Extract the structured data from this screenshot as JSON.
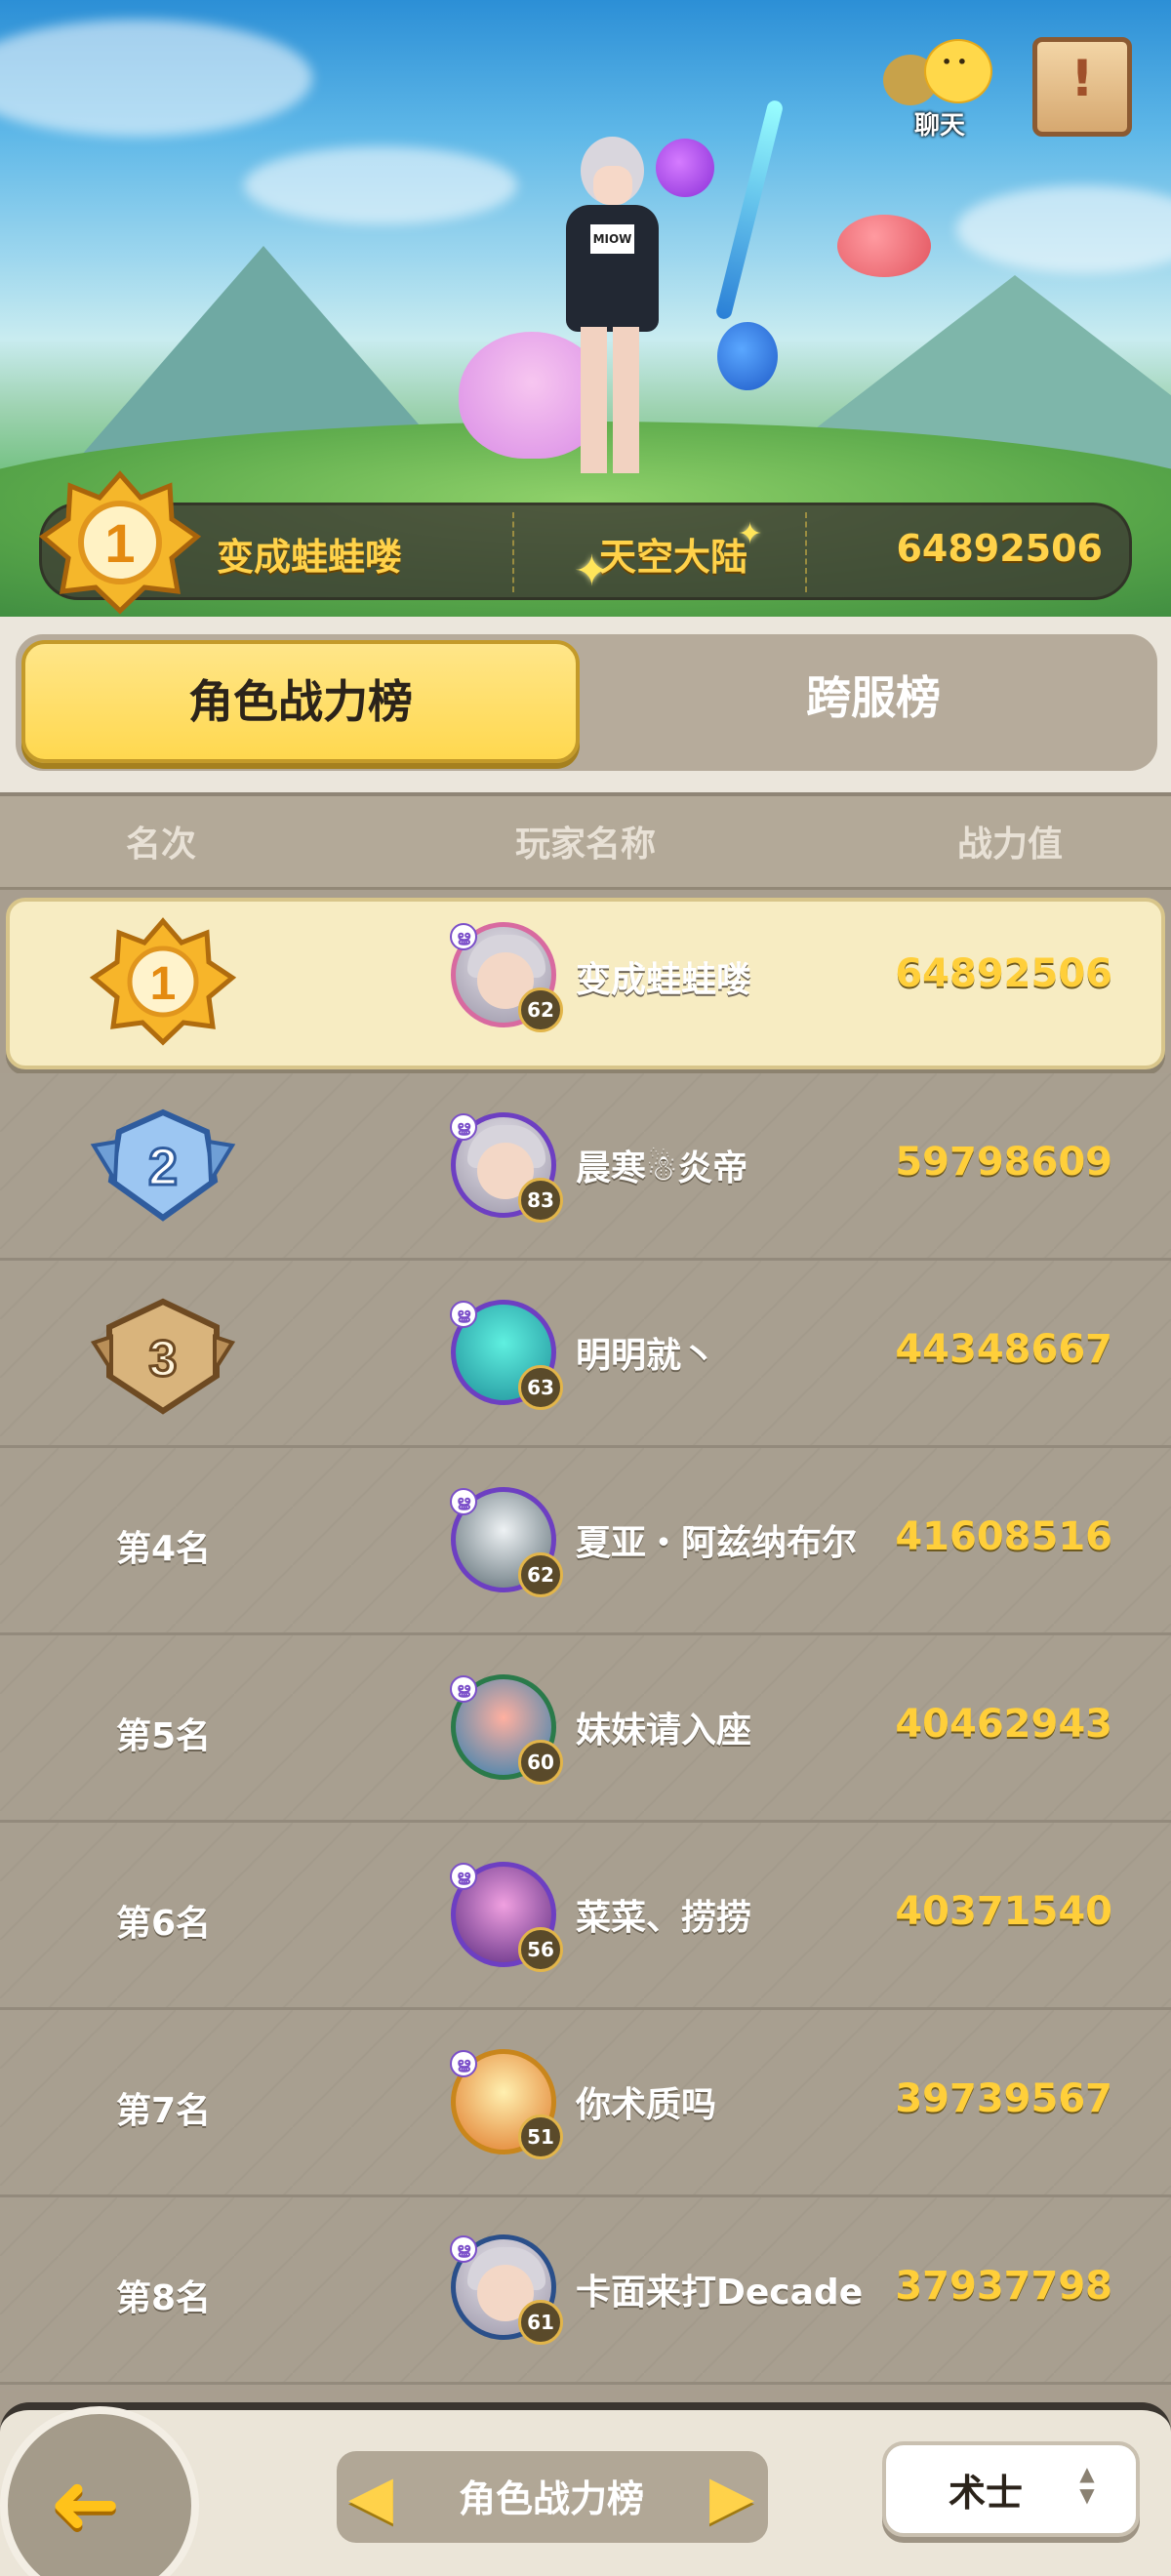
{
  "hero": {
    "chat_label": "聊天",
    "notice_icon": "!",
    "shirt_text": "MIOW"
  },
  "champion": {
    "rank": "1",
    "name": "变成蛙蛙喽",
    "server": "天空大陆",
    "power": "64892506"
  },
  "tabs": [
    {
      "label": "角色战力榜",
      "active": true
    },
    {
      "label": "跨服榜",
      "active": false
    }
  ],
  "table": {
    "headers": {
      "rank": "名次",
      "name": "玩家名称",
      "power": "战力值"
    },
    "rows": [
      {
        "rank_label": "1",
        "name": "变成蛙蛙喽",
        "level": "62",
        "power": "64892506"
      },
      {
        "rank_label": "2",
        "name": "晨寒☃炎帝",
        "level": "83",
        "power": "59798609"
      },
      {
        "rank_label": "3",
        "name": "明明就丶",
        "level": "63",
        "power": "44348667"
      },
      {
        "rank_label": "第4名",
        "name": "夏亚・阿兹纳布尔",
        "level": "62",
        "power": "41608516"
      },
      {
        "rank_label": "第5名",
        "name": "妹妹请入座",
        "level": "60",
        "power": "40462943"
      },
      {
        "rank_label": "第6名",
        "name": "菜菜、捞捞",
        "level": "56",
        "power": "40371540"
      },
      {
        "rank_label": "第7名",
        "name": "你术质吗",
        "level": "51",
        "power": "39739567"
      },
      {
        "rank_label": "第8名",
        "name": "卡面来打Decade",
        "level": "61",
        "power": "37937798"
      }
    ]
  },
  "footer": {
    "switcher_label": "角色战力榜",
    "class_label": "术士",
    "switch_left_icon": "◀",
    "switch_right_icon": "▶",
    "back_icon": "➜"
  },
  "colors": {
    "gold_text": "#ffcf3a",
    "tab_active": "#ffd84f",
    "row_bg": "#a89f90",
    "first_row_bg": "#f7ecc2"
  }
}
